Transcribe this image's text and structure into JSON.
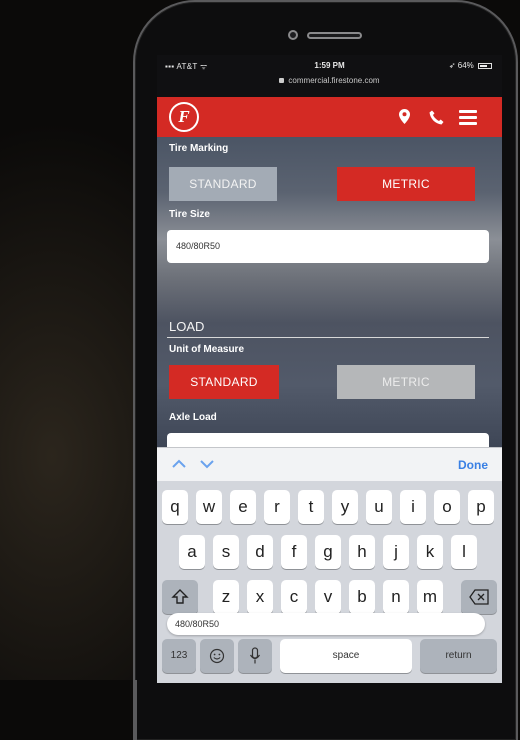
{
  "status_bar": {
    "carrier": "AT&T",
    "time": "1:59 PM",
    "battery": "64%",
    "url": "commercial.firestone.com"
  },
  "navbar": {
    "logo_letter": "F"
  },
  "tire_marking": {
    "label": "Tire Marking",
    "options": [
      "STANDARD",
      "METRIC"
    ],
    "selected": "METRIC"
  },
  "tire_size": {
    "label": "Tire Size",
    "value": "480/80R50"
  },
  "load_section": {
    "title": "LOAD"
  },
  "unit_of_measure": {
    "label": "Unit of Measure",
    "options": [
      "STANDARD",
      "METRIC"
    ],
    "selected": "STANDARD"
  },
  "axle_load": {
    "label": "Axle Load"
  },
  "keyboard": {
    "done_label": "Done",
    "row1": [
      "q",
      "w",
      "e",
      "r",
      "t",
      "y",
      "u",
      "i",
      "o",
      "p"
    ],
    "row2": [
      "a",
      "s",
      "d",
      "f",
      "g",
      "h",
      "j",
      "k",
      "l"
    ],
    "row3": [
      "z",
      "x",
      "c",
      "v",
      "b",
      "n",
      "m"
    ],
    "suggestion": "480/80R50",
    "numbers_label": "123",
    "space_label": "space",
    "return_label": "return"
  }
}
